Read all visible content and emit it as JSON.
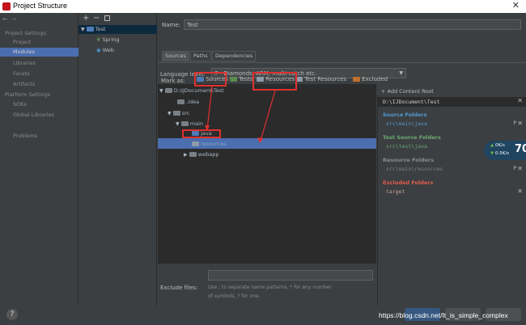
{
  "window": {
    "title": "Project Structure"
  },
  "nav": {
    "header1": "Project Settings",
    "items1": [
      "Project",
      "Modules",
      "Libraries",
      "Facets",
      "Artifacts"
    ],
    "header2": "Platform Settings",
    "items2": [
      "SDKs",
      "Global Libraries"
    ],
    "problems": "Problems"
  },
  "modules": {
    "root": "Test",
    "children": [
      "Spring",
      "Web"
    ]
  },
  "form": {
    "name_label": "Name:",
    "name_value": "Test",
    "tabs": [
      "Sources",
      "Paths",
      "Dependencies"
    ],
    "language_label": "Language level:",
    "language_value": "7 - Diamonds, ARM, multi-catch etc.",
    "mark_as_label": "Mark as:",
    "mark_as": [
      "Sources",
      "Tests",
      "Resources",
      "Test Resources",
      "Excluded"
    ]
  },
  "tree": {
    "root": "D:\\IJDocument\\Test",
    "idea": ".idea",
    "src": "src",
    "main": "main",
    "java": "java",
    "resources": "resources",
    "webapp": "webapp"
  },
  "exclude": {
    "label": "Exclude files:",
    "hint1": "Use ; to separate name patterns, * for any number",
    "hint2": "of symbols, ? for one."
  },
  "rightpanel": {
    "add_root": "Add Content Root",
    "root_path": "D:\\IJDocument\\Test",
    "source_header": "Source Folders",
    "source_path": "src\\main\\java",
    "test_header": "Test Source Folders",
    "test_path": "src\\test\\java",
    "resource_header": "Resource Folders",
    "resource_path": "src\\main\\resources",
    "excluded_header": "Excluded Folders",
    "excluded_path": "target"
  },
  "widget": {
    "up": "0K/s",
    "down": "0.5K/s",
    "pct": "70"
  },
  "watermark": "https://blog.csdn.net/It_is_simple_complex",
  "help": "?",
  "colors": {
    "selection": "#4b6eaf",
    "annotation": "#e03030",
    "source_header": "#4e9ad6",
    "test_header": "#6aab73",
    "excluded_header": "#e25c4c"
  }
}
